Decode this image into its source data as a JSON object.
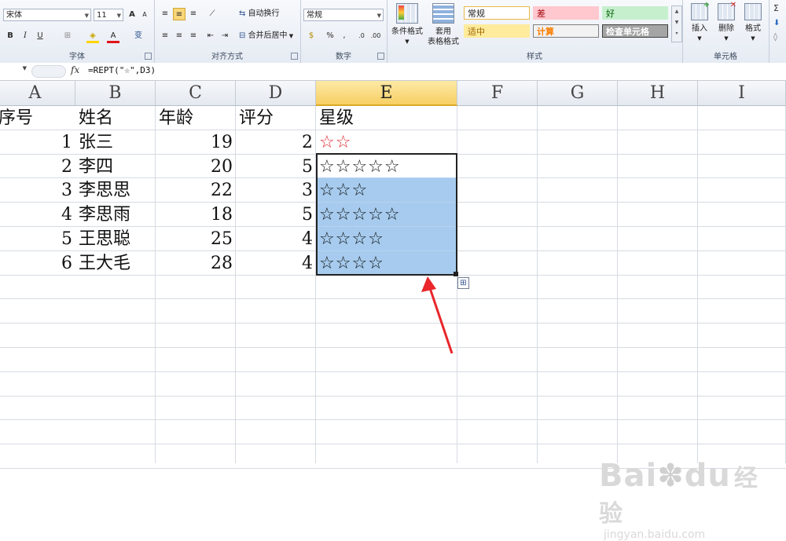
{
  "ribbon": {
    "font_group": {
      "label": "字体",
      "font_name": "宋体",
      "font_size": "11",
      "bold": "B",
      "italic": "I",
      "underline": "U",
      "grow_font": "A",
      "shrink_font": "A",
      "font_color_glyph": "A",
      "phonetic_glyph": "变"
    },
    "align_group": {
      "label": "对齐方式",
      "wrap_text": "自动换行",
      "merge_center": "合并后居中"
    },
    "number_group": {
      "label": "数字",
      "format": "常规",
      "percent": "%",
      "comma": ","
    },
    "styles_group": {
      "label": "样式",
      "conditional_format": "条件格式",
      "table_format_line1": "套用",
      "table_format_line2": "表格格式",
      "cell_styles": [
        {
          "label": "常规",
          "bg": "#ffffff",
          "fg": "#222222",
          "border": "#e8b94a"
        },
        {
          "label": "差",
          "bg": "#ffc7ce",
          "fg": "#9c0006",
          "border": "#ffc7ce"
        },
        {
          "label": "好",
          "bg": "#c6efce",
          "fg": "#006100",
          "border": "#c6efce"
        },
        {
          "label": "适中",
          "bg": "#ffeb9c",
          "fg": "#9c6500",
          "border": "#ffeb9c"
        },
        {
          "label": "计算",
          "bg": "#f2f2f2",
          "fg": "#fa7d00",
          "border": "#7f7f7f"
        },
        {
          "label": "检查单元格",
          "bg": "#a5a5a5",
          "fg": "#ffffff",
          "border": "#3f3f3f"
        }
      ]
    },
    "cells_group": {
      "label": "单元格",
      "insert": "插入",
      "delete": "删除",
      "format": "格式"
    }
  },
  "formula_bar": {
    "fx": "fx",
    "formula": "=REPT(\"☆\",D3)"
  },
  "sheet": {
    "columns": [
      "A",
      "B",
      "C",
      "D",
      "E",
      "F",
      "G",
      "H",
      "I"
    ],
    "active_column": "E",
    "headers": {
      "a": "序号",
      "b": "姓名",
      "c": "年龄",
      "d": "评分",
      "e": "星级"
    },
    "rows": [
      {
        "a": "1",
        "b": "张三",
        "c": "19",
        "d": "2",
        "e": "☆☆"
      },
      {
        "a": "2",
        "b": "李四",
        "c": "20",
        "d": "5",
        "e": "☆☆☆☆☆"
      },
      {
        "a": "3",
        "b": "李思思",
        "c": "22",
        "d": "3",
        "e": "☆☆☆"
      },
      {
        "a": "4",
        "b": "李思雨",
        "c": "18",
        "d": "5",
        "e": "☆☆☆☆☆"
      },
      {
        "a": "5",
        "b": "王思聪",
        "c": "25",
        "d": "4",
        "e": "☆☆☆☆"
      },
      {
        "a": "6",
        "b": "王大毛",
        "c": "28",
        "d": "4",
        "e": "☆☆☆☆"
      }
    ],
    "star_color_first_row": "#e0282e",
    "selection_fill": "#a6cbee",
    "annotation_arrow_color": "#e8262b"
  },
  "watermark": {
    "brand": "Bai",
    "brand2": "du",
    "brand_cn": "经验",
    "url": "jingyan.baidu.com"
  }
}
